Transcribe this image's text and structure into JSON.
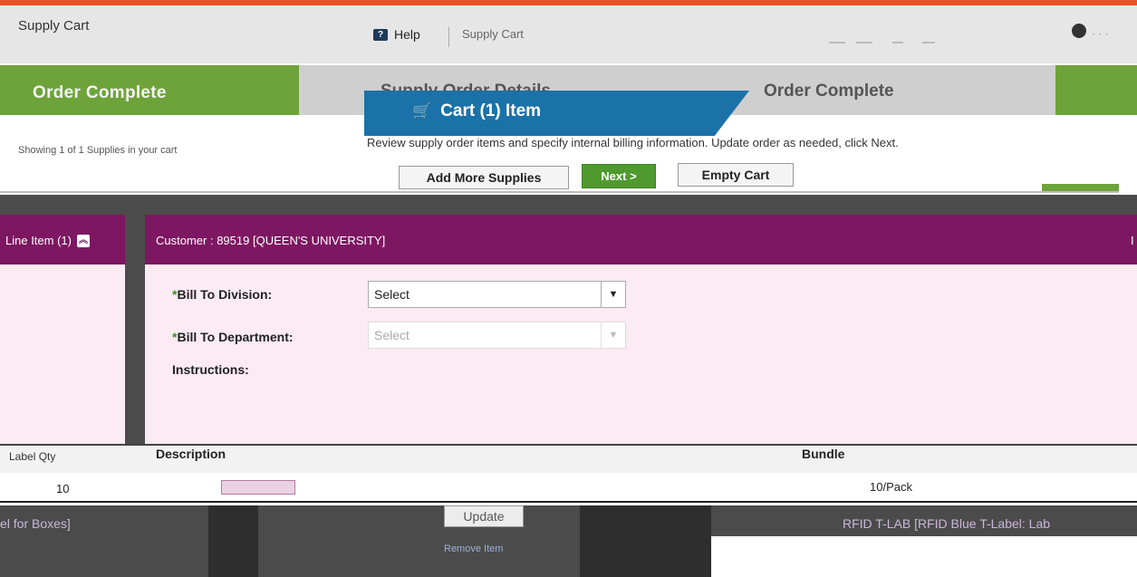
{
  "header": {
    "app_title": "Supply Cart",
    "help_label": "Help",
    "breadcrumb": "Supply Cart"
  },
  "steps": {
    "left_label": "Order Complete",
    "mid_label": "Supply Order Details",
    "active_label": "Cart (1) Item",
    "right_label": "Order Complete"
  },
  "info_text": "Showing 1 of 1 Supplies in your cart",
  "review_text": "Review supply order items and specify internal billing information. Update order as needed, click Next.",
  "actions": {
    "add_more": "Add More Supplies",
    "next": "Next >",
    "empty_cart": "Empty Cart"
  },
  "left_panel": {
    "line_item": "Line Item (1)"
  },
  "customer": {
    "label": "Customer :",
    "id": "89519",
    "name": "[QUEEN'S UNIVERSITY]",
    "edge": "I"
  },
  "form": {
    "bill_division_label": "Bill To Division:",
    "bill_division_value": "Select",
    "bill_department_label": "Bill To Department:",
    "bill_department_value": "Select",
    "instructions_label": "Instructions:"
  },
  "table": {
    "left_header": "Label Qty",
    "desc_header": "Description",
    "bundle_header": "Bundle",
    "qty": "10",
    "pack": "10/Pack"
  },
  "bottom": {
    "left_text": "el for Boxes]",
    "update_button": "Update",
    "remove_label": "Remove Item",
    "right_text": "RFID T-LAB [RFID Blue T-Label: Lab"
  },
  "colors": {
    "accent_orange": "#e9532a",
    "step_green": "#6ea33a",
    "step_blue": "#1b72a8",
    "panel_purple": "#7d1761",
    "panel_pink": "#fcebf3",
    "required_green": "#3a8f2a"
  },
  "icons": {
    "help": "help-icon",
    "cart": "cart-icon",
    "collapse": "collapse-up-icon",
    "dropdown": "chevron-down-icon",
    "user": "user-icon"
  }
}
